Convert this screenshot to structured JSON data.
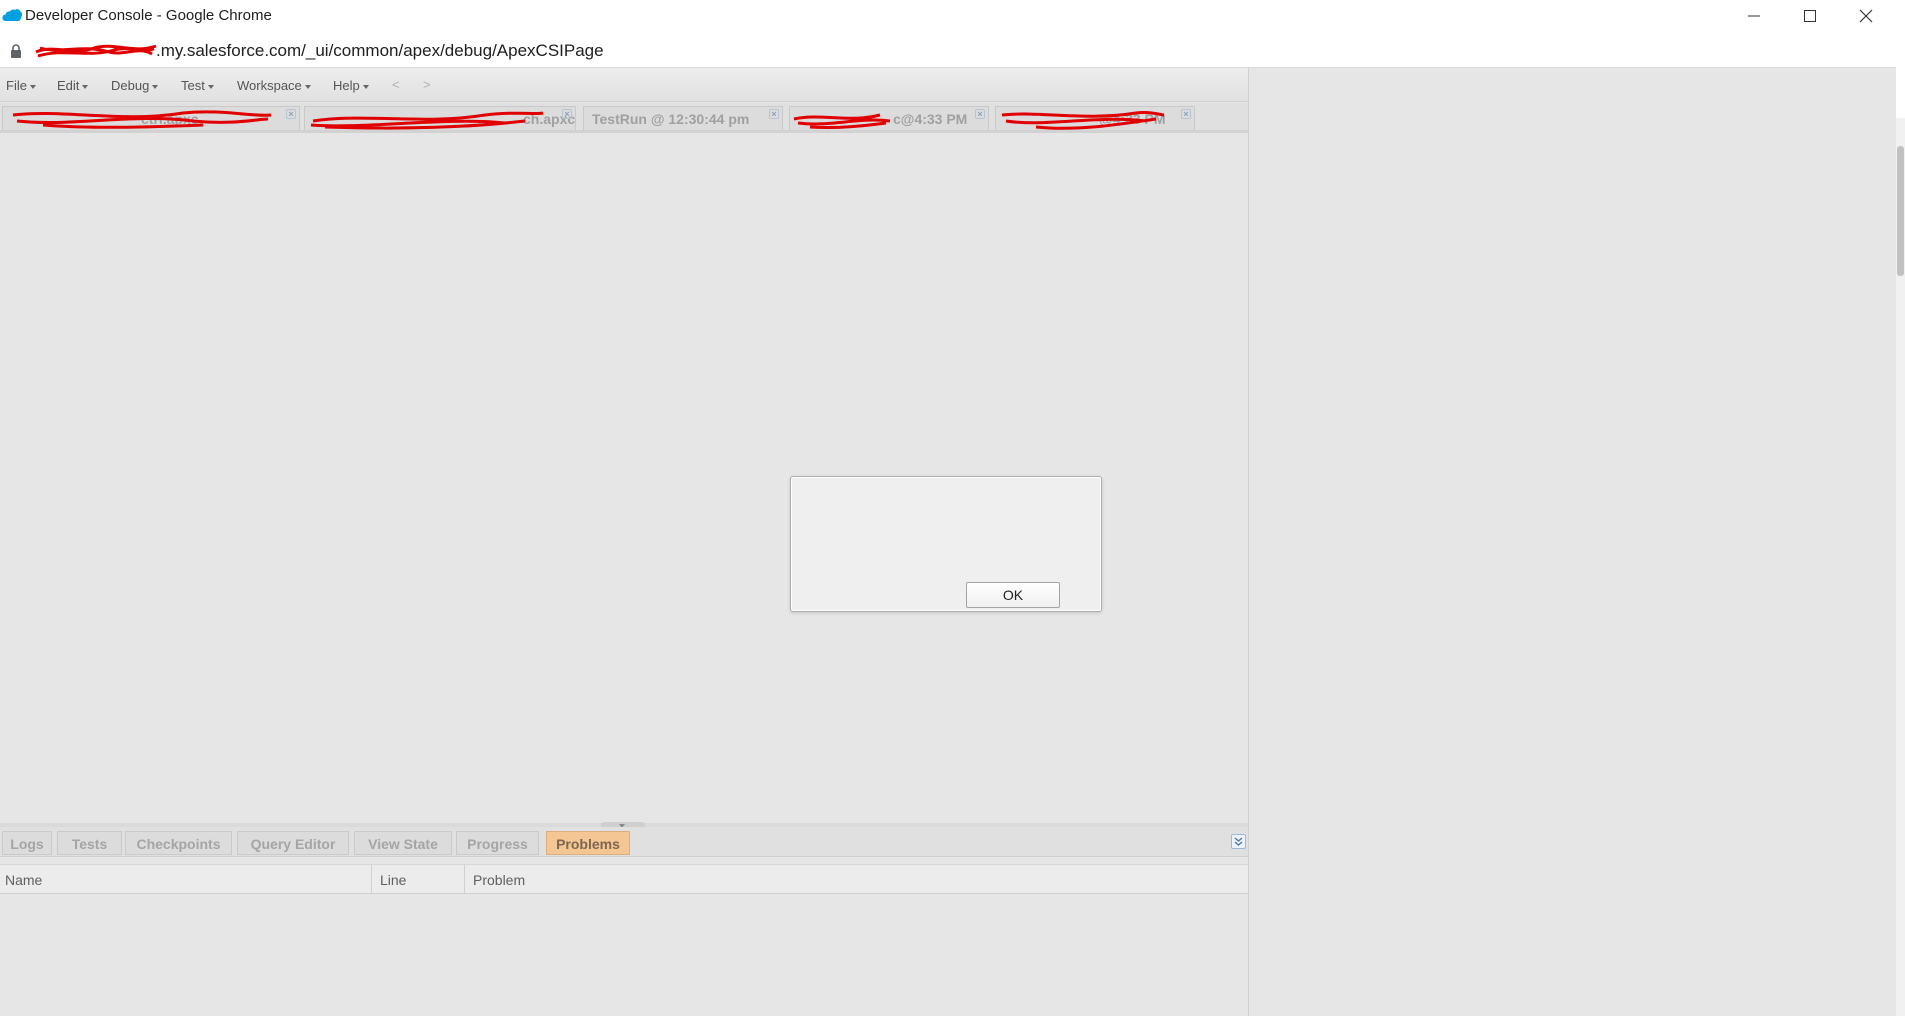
{
  "window": {
    "title": "Developer Console - Google Chrome",
    "minimize_icon": "minimize-icon",
    "maximize_icon": "maximize-icon",
    "close_icon": "close-icon"
  },
  "address": {
    "url_visible": ".my.salesforce.com/_ui/common/apex/debug/ApexCSIPage"
  },
  "menu": {
    "items": [
      {
        "label": "File"
      },
      {
        "label": "Edit"
      },
      {
        "label": "Debug"
      },
      {
        "label": "Test"
      },
      {
        "label": "Workspace"
      },
      {
        "label": "Help"
      }
    ],
    "back": "<",
    "forward": ">"
  },
  "editor_tabs": [
    {
      "label": "ctrl.apxc",
      "close": "×"
    },
    {
      "label": "ch.apxc",
      "close": "×"
    },
    {
      "label": "TestRun @ 12:30:44 pm",
      "close": "×"
    },
    {
      "label": "c@4:33 PM",
      "close": "×"
    },
    {
      "label": "@4:33 PM",
      "close": "×"
    }
  ],
  "bottom_tabs": [
    {
      "label": "Logs"
    },
    {
      "label": "Tests"
    },
    {
      "label": "Checkpoints"
    },
    {
      "label": "Query Editor"
    },
    {
      "label": "View State"
    },
    {
      "label": "Progress"
    },
    {
      "label": "Problems"
    }
  ],
  "problems_table": {
    "columns": [
      "Name",
      "Line",
      "Problem"
    ]
  },
  "dialog": {
    "message": "",
    "ok_label": "OK"
  },
  "colors": {
    "active_tab": "#f3c693",
    "redaction": "#e00000",
    "salesforce_blue": "#00a1e0"
  }
}
